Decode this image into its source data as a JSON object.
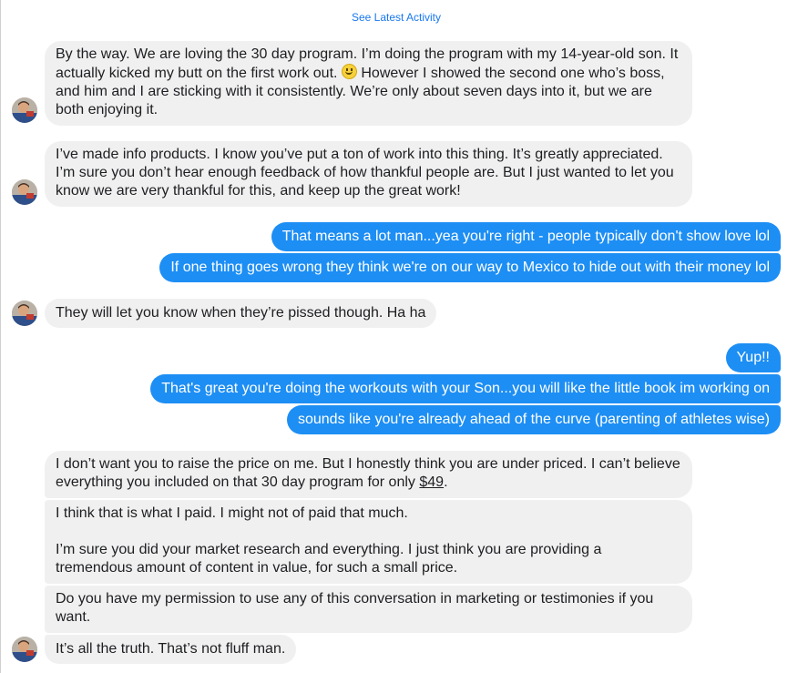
{
  "header": {
    "see_latest_label": "See Latest Activity"
  },
  "messages": {
    "m1": {
      "text": "By the way. We are loving the 30 day program. I’m doing the program with my 14-year-old son. It actually kicked my butt on the first work out.",
      "text_after_emoji": " However I showed the second one who’s boss, and him and I are sticking with it consistently. We’re only about seven days into it, but we are both enjoying it."
    },
    "m2": "I’ve made info products. I know you’ve put a ton of work into this thing. It’s greatly appreciated. I’m sure you don’t hear enough feedback of how thankful people are. But I just wanted to let you know we are very thankful for this, and keep up the great work!",
    "o1": "That means a lot man...yea you're right - people typically don't show love lol",
    "o2": "If one thing goes wrong they think we're on our way to Mexico to hide out with their money lol",
    "m3": "They will let you know when they’re pissed though. Ha ha",
    "o3": "Yup!!",
    "o4": "That's great you're doing the workouts with your Son...you will like the little book im working on",
    "o5": "sounds like you're already ahead of the curve (parenting of athletes wise)",
    "m4": {
      "text_before_price": "I don’t want you to raise the price on me. But I honestly think you are under priced. I can’t believe everything you included on that 30 day program for only ",
      "price": "$49",
      "text_after_price": "."
    },
    "m5": {
      "para1": "I think that is what I paid. I might not of paid that much.",
      "para2": "I’m sure you did your market research and everything. I just think you are providing a tremendous amount of content in value, for such a small price."
    },
    "m6": "Do you have my permission to use any of this conversation in marketing or testimonies if you want.",
    "m7": "It’s all the truth. That’s not fluff man."
  },
  "colors": {
    "outgoing_bubble": "#1d8ef4",
    "incoming_bubble": "#f1f0f0",
    "link": "#1877f2"
  },
  "icons": {
    "emoji": "slightly-smiling-face-icon",
    "avatar": "user-avatar"
  }
}
